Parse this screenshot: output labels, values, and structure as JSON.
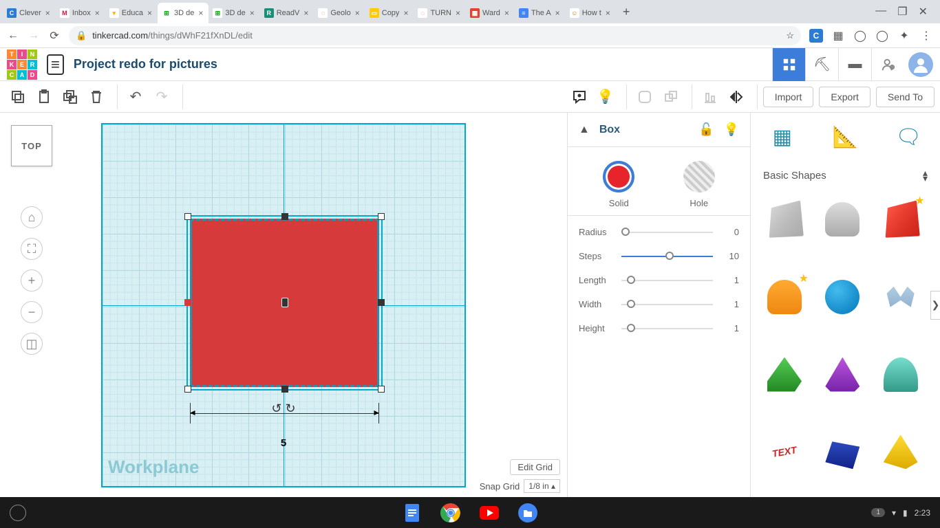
{
  "browser": {
    "tabs": [
      {
        "favicon_bg": "#2e7cd1",
        "favicon_fg": "#fff",
        "glyph": "C",
        "title": "Clever"
      },
      {
        "favicon_bg": "#fff",
        "favicon_fg": "#d14",
        "glyph": "M",
        "title": "Inbox"
      },
      {
        "favicon_bg": "#fff",
        "favicon_fg": "#f7b500",
        "glyph": "▾",
        "title": "Educa"
      },
      {
        "favicon_bg": "#fff",
        "favicon_fg": "#0a0",
        "glyph": "⊞",
        "title": "3D de",
        "active": true
      },
      {
        "favicon_bg": "#fff",
        "favicon_fg": "#0a0",
        "glyph": "⊞",
        "title": "3D de"
      },
      {
        "favicon_bg": "#1a8f78",
        "favicon_fg": "#fff",
        "glyph": "R",
        "title": "ReadV"
      },
      {
        "favicon_bg": "#fff",
        "favicon_fg": "#d33",
        "glyph": "◌",
        "title": "Geolo"
      },
      {
        "favicon_bg": "#ffcc00",
        "favicon_fg": "#fff",
        "glyph": "▭",
        "title": "Copy"
      },
      {
        "favicon_bg": "#fff",
        "favicon_fg": "#d33",
        "glyph": "◌",
        "title": "TURN"
      },
      {
        "favicon_bg": "#e84030",
        "favicon_fg": "#fff",
        "glyph": "▦",
        "title": "Ward"
      },
      {
        "favicon_bg": "#4285f4",
        "favicon_fg": "#fff",
        "glyph": "≡",
        "title": "The A"
      },
      {
        "favicon_bg": "#fff",
        "favicon_fg": "#c70",
        "glyph": "☺",
        "title": "How t"
      }
    ],
    "url_host": "tinkercad.com",
    "url_path": "/things/dWhF21fXnDL/edit"
  },
  "header": {
    "project_title": "Project redo for pictures",
    "logo_letters": [
      "T",
      "I",
      "N",
      "K",
      "E",
      "R",
      "C",
      "A",
      "D"
    ]
  },
  "toolbar": {
    "import_label": "Import",
    "export_label": "Export",
    "sendto_label": "Send To"
  },
  "viewcube": {
    "face": "TOP"
  },
  "workplane": {
    "label": "Workplane",
    "dim_value": "5"
  },
  "properties": {
    "shape_name": "Box",
    "solid_label": "Solid",
    "hole_label": "Hole",
    "sliders": [
      {
        "label": "Radius",
        "value": "0",
        "thumb_pct": 0
      },
      {
        "label": "Steps",
        "value": "10",
        "thumb_pct": 48
      },
      {
        "label": "Length",
        "value": "1",
        "thumb_pct": 6
      },
      {
        "label": "Width",
        "value": "1",
        "thumb_pct": 6
      },
      {
        "label": "Height",
        "value": "1",
        "thumb_pct": 6
      }
    ]
  },
  "library": {
    "category": "Basic Shapes",
    "shapes": [
      {
        "name": "box-gray",
        "starred": false
      },
      {
        "name": "cylinder-gray",
        "starred": false
      },
      {
        "name": "box-red",
        "starred": true
      },
      {
        "name": "cylinder-orange",
        "starred": true
      },
      {
        "name": "sphere-blue",
        "starred": false
      },
      {
        "name": "scribble",
        "starred": false
      },
      {
        "name": "roof-green",
        "starred": false
      },
      {
        "name": "cone-purple",
        "starred": false
      },
      {
        "name": "half-cylinder",
        "starred": false
      },
      {
        "name": "text-red",
        "starred": false
      },
      {
        "name": "polygon-blue",
        "starred": false
      },
      {
        "name": "pyramid-yellow",
        "starred": false
      }
    ],
    "text_shape_glyph": "TEXT"
  },
  "footer": {
    "edit_grid": "Edit Grid",
    "snap_label": "Snap Grid",
    "snap_value": "1/8 in"
  },
  "taskbar": {
    "notif": "1",
    "time": "2:23"
  }
}
